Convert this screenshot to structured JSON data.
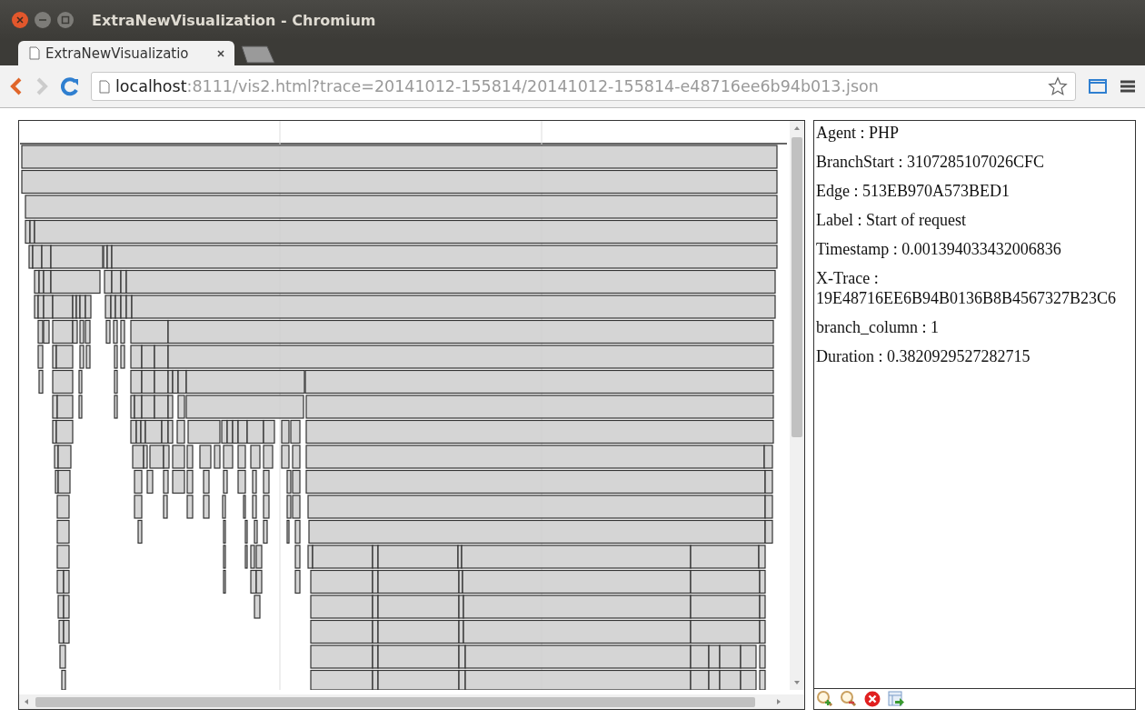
{
  "window": {
    "title": "ExtraNewVisualization - Chromium"
  },
  "tabs": [
    {
      "label": "ExtraNewVisualizatio",
      "selected": true
    }
  ],
  "address_bar": {
    "host": "localhost",
    "path": ":8111/vis2.html?trace=20141012-155814/20141012-155814-e48716ee6b94b013.json"
  },
  "details": [
    "Agent : PHP",
    "BranchStart : 3107285107026CFC",
    "Edge : 513EB970A573BED1",
    "Label : Start of request",
    "Timestamp : 0.001394033432006836",
    "X-Trace : 19E48716EE6B94B0136B8B4567327B23C6",
    "branch_column : 1",
    "Duration : 0.3820929527282715"
  ]
}
